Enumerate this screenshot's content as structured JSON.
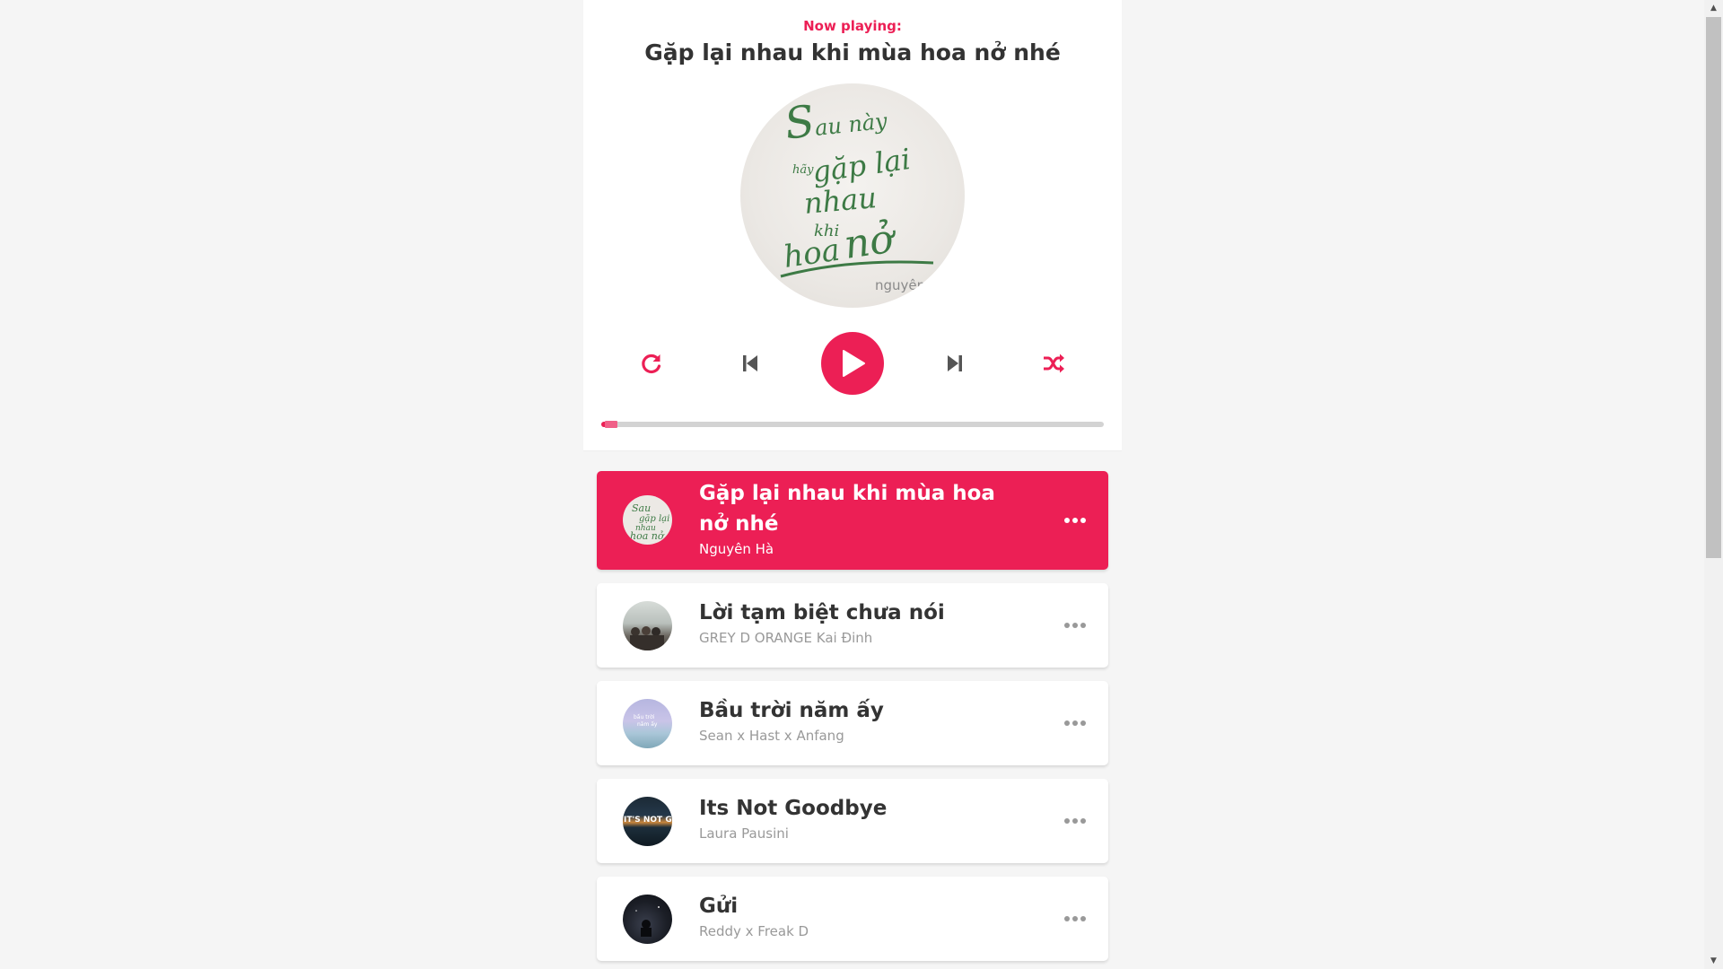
{
  "header": {
    "now_playing_label": "Now playing:",
    "title": "Gặp lại nhau khi mùa hoa nở nhé"
  },
  "cd": {
    "art_lettering": [
      "Sau này",
      "hãy",
      "gặp lại",
      "nhau",
      "khi",
      "hoa nở",
      "nguyên"
    ]
  },
  "controls": {
    "repeat_icon": "repeat-icon",
    "prev_icon": "step-backward-icon",
    "play_icon": "play-icon",
    "next_icon": "step-forward-icon",
    "random_icon": "shuffle-icon"
  },
  "progress": {
    "percent": 2
  },
  "playlist": [
    {
      "title": "Gặp lại nhau khi mùa hoa nở nhé",
      "author": "Nguyên Hà",
      "active": true
    },
    {
      "title": "Lời tạm biệt chưa nói",
      "author": "GREY D ORANGE Kai Đinh",
      "active": false
    },
    {
      "title": "Bầu trời năm ấy",
      "author": "Sean x Hast x Anfang",
      "active": false
    },
    {
      "title": "Its Not Goodbye",
      "author": "Laura Pausini",
      "active": false,
      "thumb_text": "IT'S NOT G"
    },
    {
      "title": "Gửi",
      "author": "Reddy x Freak D",
      "active": false
    }
  ],
  "colors": {
    "accent": "#ec1f55",
    "text": "#333333",
    "muted": "#999999",
    "background": "#f5f5f5"
  }
}
